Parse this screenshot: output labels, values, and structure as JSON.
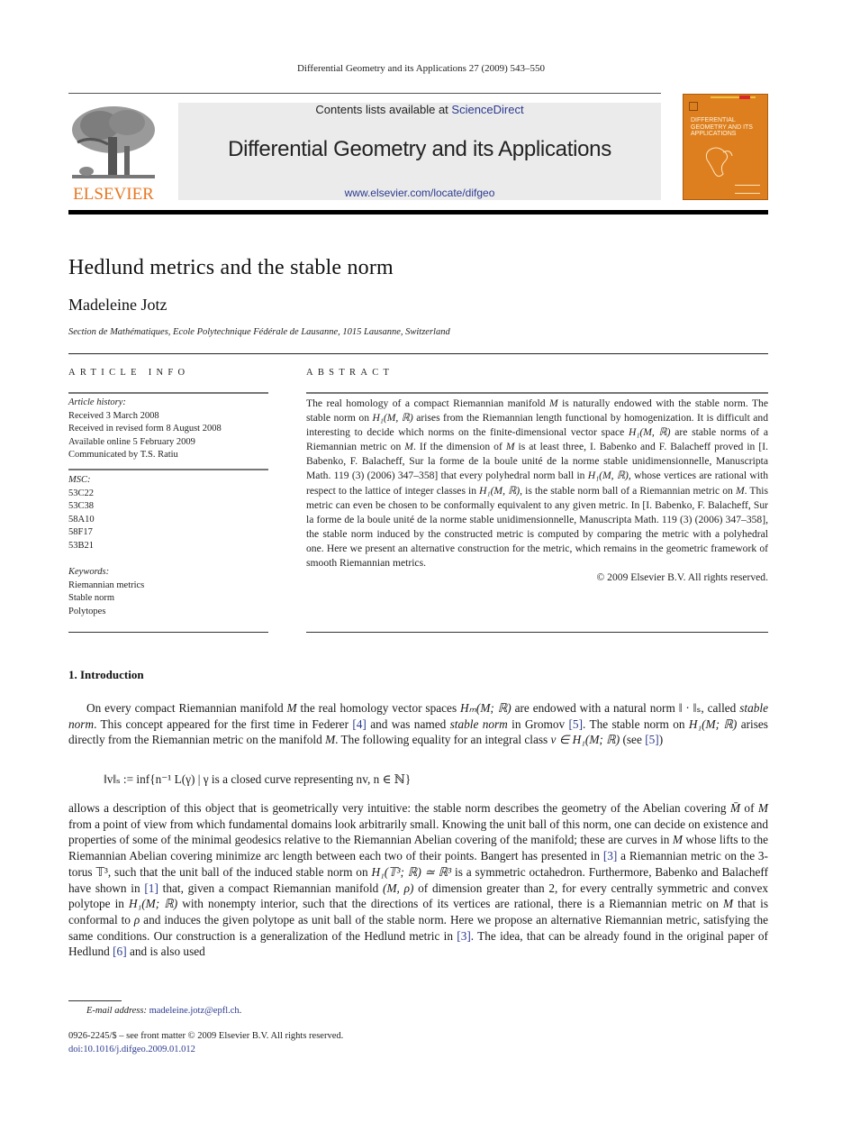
{
  "running_head": "Differential Geometry and its Applications 27 (2009) 543–550",
  "masthead": {
    "publisher_logo_text": "ELSEVIER",
    "contents_prefix": "Contents lists available at ",
    "contents_link": "ScienceDirect",
    "journal_title": "Differential Geometry and its Applications",
    "journal_url": "www.elsevier.com/locate/difgeo",
    "cover_title": "DIFFERENTIAL GEOMETRY AND ITS APPLICATIONS",
    "colors": {
      "elsevier_orange": "#e87722",
      "cover_orange": "#dd7f1f",
      "link_blue": "#2b3a8f",
      "banner_gray": "#ebebeb"
    }
  },
  "article": {
    "title": "Hedlund metrics and the stable norm",
    "author": "Madeleine Jotz",
    "affiliation": "Section de Mathématiques, Ecole Polytechnique Fédérale de Lausanne, 1015 Lausanne, Switzerland"
  },
  "article_info": {
    "heading": "ARTICLE INFO",
    "history_label": "Article history:",
    "history": [
      "Received 3 March 2008",
      "Received in revised form 8 August 2008",
      "Available online 5 February 2009",
      "Communicated by T.S. Ratiu"
    ],
    "msc_label": "MSC:",
    "msc": [
      "53C22",
      "53C38",
      "58A10",
      "58F17",
      "53B21"
    ],
    "keywords_label": "Keywords:",
    "keywords": [
      "Riemannian metrics",
      "Stable norm",
      "Polytopes"
    ]
  },
  "abstract": {
    "heading": "ABSTRACT",
    "s1": "The real homology of a compact Riemannian manifold ",
    "s2": " is naturally endowed with the stable norm. The stable norm on ",
    "s3": " arises from the Riemannian length functional by homogenization. It is difficult and interesting to decide which norms on the finite-dimensional vector space ",
    "s4": " are stable norms of a Riemannian metric on ",
    "s5": ". If the dimension of ",
    "s6": " is at least three, I. Babenko and F. Balacheff proved in [I. Babenko, F. Balacheff, Sur la forme de la boule unité de la norme stable unidimensionnelle, Manuscripta Math. 119 (3) (2006) 347–358] that every polyhedral norm ball in ",
    "s7": ", whose vertices are rational with respect to the lattice of integer classes in ",
    "s8": ", is the stable norm ball of a Riemannian metric on ",
    "s9": ". This metric can even be chosen to be conformally equivalent to any given metric. In [I. Babenko, F. Balacheff, Sur la forme de la boule unité de la norme stable unidimensionnelle, Manuscripta Math. 119 (3) (2006) 347–358], the stable norm induced by the constructed metric is computed by comparing the metric with a polyhedral one. Here we present an alternative construction for the metric, which remains in the geometric framework of smooth Riemannian metrics.",
    "M": "M",
    "H1MR": "H₁(M, ℝ)",
    "copyright": "© 2009 Elsevier B.V. All rights reserved."
  },
  "introduction": {
    "heading": "1. Introduction",
    "p1": {
      "a": "On every compact Riemannian manifold ",
      "M": "M",
      "b": " the real homology vector spaces ",
      "Hm": "Hₘ(M; ℝ)",
      "c": " are endowed with a natural norm ",
      "norm": "‖ · ‖ₛ",
      "d": ", called ",
      "stable_norm": "stable norm",
      "e": ". This concept appeared for the first time in Federer ",
      "ref4": "[4]",
      "f": " and was named ",
      "g": " in Gromov ",
      "ref5": "[5]",
      "h": ". The stable norm on ",
      "H1": "H₁(M; ℝ)",
      "i": " arises directly from the Riemannian metric on the manifold ",
      "j": ". The following equality for an integral class ",
      "vin": "v ∈ H₁(M; ℝ)",
      "k": " (see ",
      "l": ")"
    },
    "equation": "‖v‖ₛ := inf{n⁻¹ L(γ) | γ is a closed curve representing nv,  n ∈ ℕ}",
    "p2": {
      "a": "allows a description of this object that is geometrically very intuitive: the stable norm describes the geometry of the Abelian covering ",
      "Mbar": "M̄",
      "b": " of ",
      "M": "M",
      "c": " from a point of view from which fundamental domains look arbitrarily small. Knowing the unit ball of this norm, one can decide on existence and properties of some of the minimal geodesics relative to the Riemannian Abelian covering of the manifold; these are curves in ",
      "d": " whose lifts to the Riemannian Abelian covering minimize arc length between each two of their points. Bangert has presented in ",
      "ref3": "[3]",
      "e": " a Riemannian metric on the 3-torus ",
      "T3": "𝕋³",
      "f": ", such that the unit ball of the induced stable norm on ",
      "H1T3": "H₁(𝕋³; ℝ) ≃ ℝ³",
      "g": " is a symmetric octahedron. Furthermore, Babenko and Balacheff have shown in ",
      "ref1": "[1]",
      "h": " that, given a compact Riemannian manifold ",
      "Mrho": "(M, ρ)",
      "i": " of dimension greater than 2, for every centrally symmetric and convex polytope in ",
      "H1": "H₁(M; ℝ)",
      "j": " with nonempty interior, such that the directions of its vertices are rational, there is a Riemannian metric on ",
      "k": " that is conformal to ",
      "rho": "ρ",
      "l": " and induces the given polytope as unit ball of the stable norm. Here we propose an alternative Riemannian metric, satisfying the same conditions. Our construction is a generalization of the Hedlund metric in ",
      "m": ". The idea, that can be already found in the original paper of Hedlund ",
      "ref6": "[6]",
      "n": " and is also used"
    }
  },
  "footnote": {
    "label": "E-mail address: ",
    "email": "madeleine.jotz@epfl.ch",
    "end": "."
  },
  "front_matter": {
    "issn_line": "0926-2245/$ – see front matter  © 2009 Elsevier B.V. All rights reserved.",
    "doi": "doi:10.1016/j.difgeo.2009.01.012"
  }
}
